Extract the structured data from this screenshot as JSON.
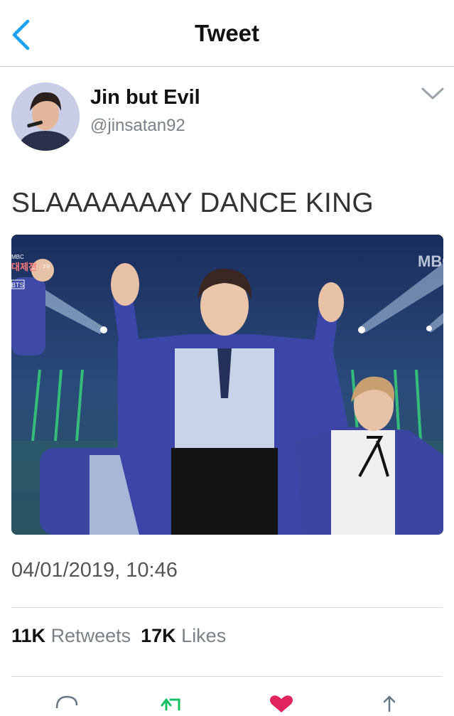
{
  "nav": {
    "title": "Tweet",
    "back_icon": "chevron-left-icon"
  },
  "author": {
    "name": "Jin but Evil",
    "handle": "@jinsatan92",
    "avatar": "avatar",
    "menu_icon": "chevron-down-icon"
  },
  "tweet": {
    "text": "SLAAAAAAAY DANCE KING",
    "media_overlay": {
      "broadcaster": "MBC",
      "logo_small": "MBC",
      "badge_text": "대제전",
      "part_label": "2부",
      "group_label": "BTS"
    },
    "timestamp": "04/01/2019, 10:46"
  },
  "stats": {
    "retweets_count": "11K",
    "retweets_label": "Retweets",
    "likes_count": "17K",
    "likes_label": "Likes"
  },
  "actions": {
    "reply_icon": "reply-icon",
    "retweet_icon": "retweet-icon",
    "like_icon": "heart-icon",
    "share_icon": "share-icon"
  },
  "colors": {
    "accent": "#1da1f2",
    "retweet": "#17bf63",
    "like": "#e0245e",
    "text_primary": "#14171a",
    "text_secondary": "#7a8288",
    "divider": "#d8d8dc"
  }
}
